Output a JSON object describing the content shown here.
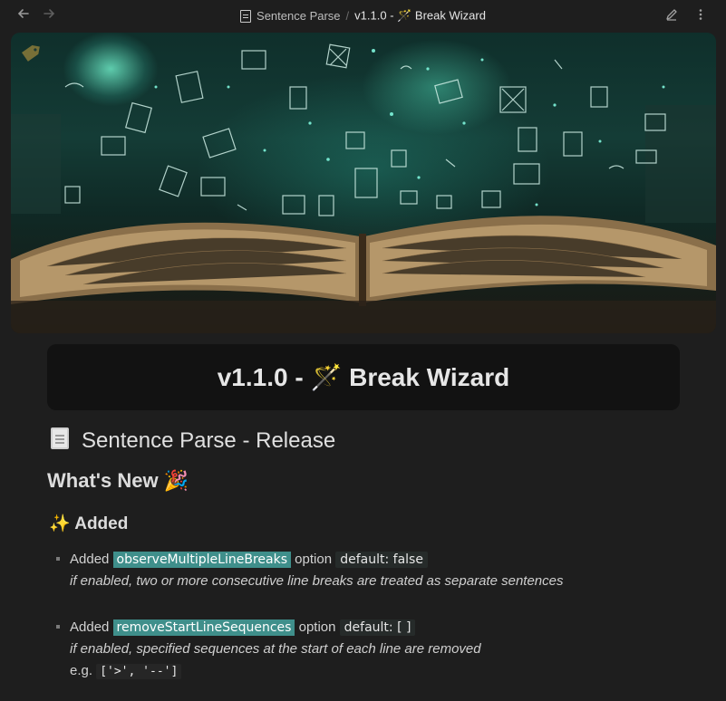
{
  "topbar": {
    "back_icon": "arrow-left-icon",
    "forward_icon": "arrow-right-icon",
    "breadcrumb_parent": "Sentence Parse",
    "breadcrumb_separator": "/",
    "breadcrumb_current": "v1.1.0 - 🪄 Break Wizard",
    "edit_icon": "pencil-icon",
    "more_icon": "more-vertical-icon"
  },
  "banner": {
    "tag_icon": "tag-icon"
  },
  "title_card": {
    "title": "v1.1.0 - 🪄 Break Wizard"
  },
  "doc_heading": {
    "icon": "document-icon",
    "text": "Sentence Parse - Release"
  },
  "whats_new": {
    "text": "What's New 🎉"
  },
  "added": {
    "text": "✨ Added"
  },
  "items": [
    {
      "prefix": "Added",
      "option_name": "observeMultipleLineBreaks",
      "option_word": "option",
      "default": "default: false",
      "description": "if enabled, two or more consecutive line breaks are treated as separate sentences"
    },
    {
      "prefix": "Added",
      "option_name": "removeStartLineSequences",
      "option_word": "option",
      "default": "default: [ ]",
      "description": "if enabled, specified sequences at the start of each line are removed",
      "example_prefix": "e.g.",
      "example_code": "['>', '--']"
    }
  ],
  "colors": {
    "background": "#1e1e1e",
    "title_card": "#121212",
    "highlight": "#3f8f8b",
    "banner_glow": "#3fe0c0"
  }
}
